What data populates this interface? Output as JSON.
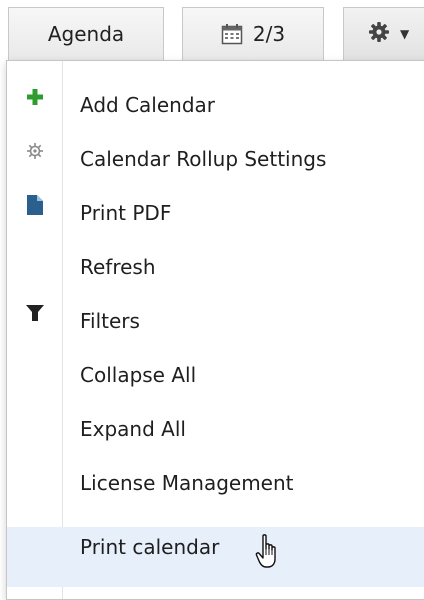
{
  "toolbar": {
    "agenda_label": "Agenda",
    "date_label": "2/3",
    "icons": {
      "date": "calendar-icon",
      "settings": "gear-icon",
      "dropdown": "caret-down-icon"
    }
  },
  "menu": {
    "items": [
      {
        "label": "Add Calendar",
        "icon": "plus-icon",
        "icon_color": "#2e9c2e"
      },
      {
        "label": "Calendar Rollup Settings",
        "icon": "gear-icon",
        "icon_color": "#8a8a8a"
      },
      {
        "label": "Print PDF",
        "icon": "document-icon",
        "icon_color": "#2a5f8e"
      },
      {
        "label": "Refresh",
        "icon": ""
      },
      {
        "label": "Filters",
        "icon": "filter-icon",
        "icon_color": "#222222"
      },
      {
        "label": "Collapse All",
        "icon": ""
      },
      {
        "label": "Expand All",
        "icon": ""
      },
      {
        "label": "License Management",
        "icon": ""
      },
      {
        "label": "Print calendar",
        "icon": "",
        "hovered": true
      }
    ],
    "hover_color": "#e6effa"
  },
  "cursor": "hand-pointer-icon"
}
